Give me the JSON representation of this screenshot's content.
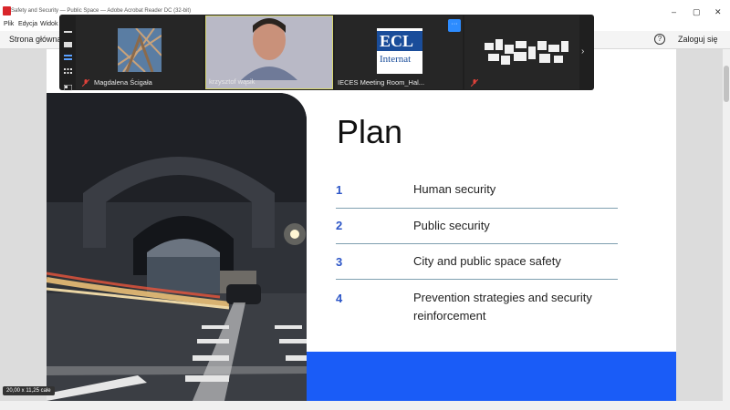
{
  "window": {
    "title": "Safety and Security — Public Space — Adobe Acrobat Reader DC (32-bit)",
    "controls": {
      "minimize": "–",
      "maximize": "▢",
      "close": "✕"
    }
  },
  "menu": {
    "items": [
      "Plik",
      "Edycja",
      "Widok"
    ]
  },
  "toolbar": {
    "home": "Strona główna",
    "help": "?",
    "login": "Zaloguj się"
  },
  "slide": {
    "title": "Plan",
    "items": [
      {
        "num": "1",
        "text": "Human security"
      },
      {
        "num": "2",
        "text": "Public security"
      },
      {
        "num": "3",
        "text": "City and public space safety"
      },
      {
        "num": "4",
        "text": "Prevention strategies and security reinforcement"
      }
    ],
    "accent_color": "#1a5cf7"
  },
  "status": {
    "page_size": "20,00 x 11,25 cale"
  },
  "zoom": {
    "participants": [
      {
        "name": "Magdalena Ścigała",
        "muted": true
      },
      {
        "name": "krzysztof wąsik",
        "muted": false
      },
      {
        "name": "IECES Meeting Room_Hal...",
        "muted": false
      },
      {
        "name": "",
        "muted": true
      }
    ],
    "more_label": "···",
    "next_label": "›",
    "logo_text_1": "ECL",
    "logo_text_2": "Internat"
  }
}
